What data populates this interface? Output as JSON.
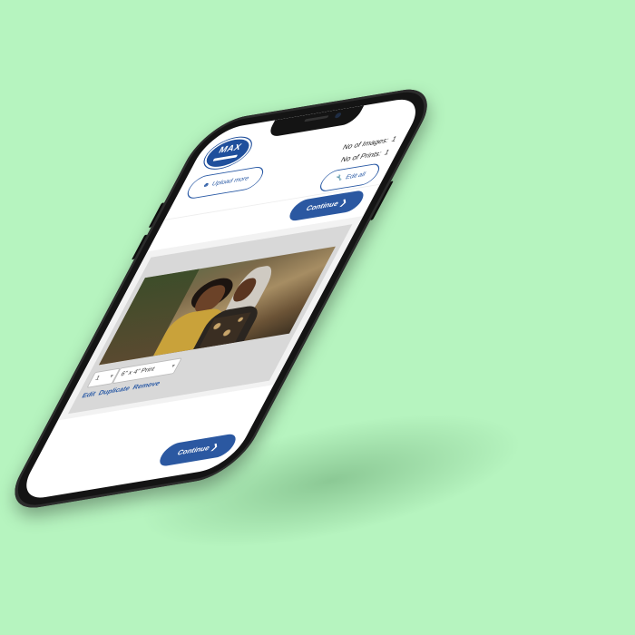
{
  "brand": {
    "logo_text": "MAX"
  },
  "stats": {
    "images_label": "No of Images:",
    "images_value": "1",
    "prints_label": "No of Prints:",
    "prints_value": "1"
  },
  "toolbar": {
    "upload_label": "Upload more",
    "edit_all_label": "Edit all",
    "continue_label": "Continue"
  },
  "photo_item": {
    "quantity": "1",
    "size": "6\" x 4\" Print",
    "actions": {
      "edit": "Edit",
      "duplicate": "Duplicate",
      "remove": "Remove"
    }
  },
  "footer": {
    "continue_label": "Continue"
  },
  "colors": {
    "background": "#b6f4bf",
    "accent": "#2b58a1"
  }
}
